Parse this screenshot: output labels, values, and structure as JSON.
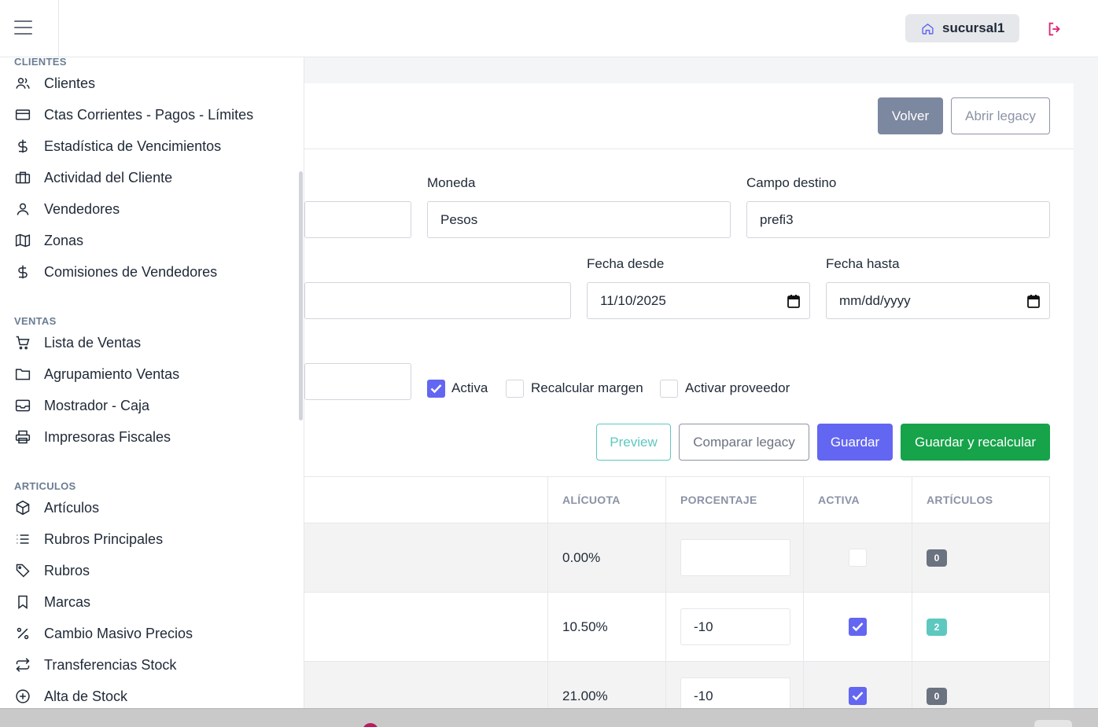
{
  "header": {
    "branch": "sucursal1"
  },
  "page": {
    "back_label": "Volver",
    "legacy_label": "Abrir legacy"
  },
  "form": {
    "moneda_label": "Moneda",
    "moneda_value": "Pesos",
    "campo_destino_label": "Campo destino",
    "campo_destino_value": "prefi3",
    "fecha_desde_label": "Fecha desde",
    "fecha_desde_value": "11/10/2025",
    "fecha_hasta_label": "Fecha hasta",
    "fecha_hasta_placeholder": "mm/dd/yyyy",
    "activa_label": "Activa",
    "activa_checked": true,
    "recalcular_label": "Recalcular margen",
    "recalcular_checked": false,
    "activar_prov_label": "Activar proveedor",
    "activar_prov_checked": false
  },
  "actions": {
    "preview": "Preview",
    "compare": "Comparar legacy",
    "save": "Guardar",
    "save_recalc": "Guardar y recalcular"
  },
  "table": {
    "headers": {
      "alicuota": "ALÍCUOTA",
      "porcentaje": "PORCENTAJE",
      "activa": "ACTIVA",
      "articulos": "ARTÍCULOS"
    },
    "rows": [
      {
        "alicuota": "0.00%",
        "porcentaje": "",
        "activa": false,
        "articulos": "0",
        "badge_color": "#6b7280"
      },
      {
        "alicuota": "10.50%",
        "porcentaje": "-10",
        "activa": true,
        "articulos": "2",
        "badge_color": "#5ec8c0"
      },
      {
        "alicuota": "21.00%",
        "porcentaje": "-10",
        "activa": true,
        "articulos": "0",
        "badge_color": "#6b7280"
      }
    ]
  },
  "sidebar": {
    "sections": [
      {
        "title": "CLIENTES",
        "items": [
          {
            "label": "Clientes",
            "icon": "users-icon"
          },
          {
            "label": "Ctas Corrientes - Pagos - Límites",
            "icon": "credit-card-icon"
          },
          {
            "label": "Estadística de Vencimientos",
            "icon": "dollar-icon"
          },
          {
            "label": "Actividad del Cliente",
            "icon": "briefcase-icon"
          },
          {
            "label": "Vendedores",
            "icon": "user-icon"
          },
          {
            "label": "Zonas",
            "icon": "map-icon"
          },
          {
            "label": "Comisiones de Vendedores",
            "icon": "dollar-icon"
          }
        ]
      },
      {
        "title": "VENTAS",
        "items": [
          {
            "label": "Lista de Ventas",
            "icon": "cart-icon"
          },
          {
            "label": "Agrupamiento Ventas",
            "icon": "folder-icon"
          },
          {
            "label": "Mostrador - Caja",
            "icon": "inbox-icon"
          },
          {
            "label": "Impresoras Fiscales",
            "icon": "printer-icon"
          }
        ]
      },
      {
        "title": "ARTICULOS",
        "items": [
          {
            "label": "Artículos",
            "icon": "box-icon"
          },
          {
            "label": "Rubros Principales",
            "icon": "list-icon"
          },
          {
            "label": "Rubros",
            "icon": "tag-icon"
          },
          {
            "label": "Marcas",
            "icon": "bookmark-icon"
          },
          {
            "label": "Cambio Masivo Precios",
            "icon": "percent-icon"
          },
          {
            "label": "Transferencias Stock",
            "icon": "repeat-icon"
          },
          {
            "label": "Alta de Stock",
            "icon": "plus-circle-icon"
          }
        ]
      }
    ]
  }
}
